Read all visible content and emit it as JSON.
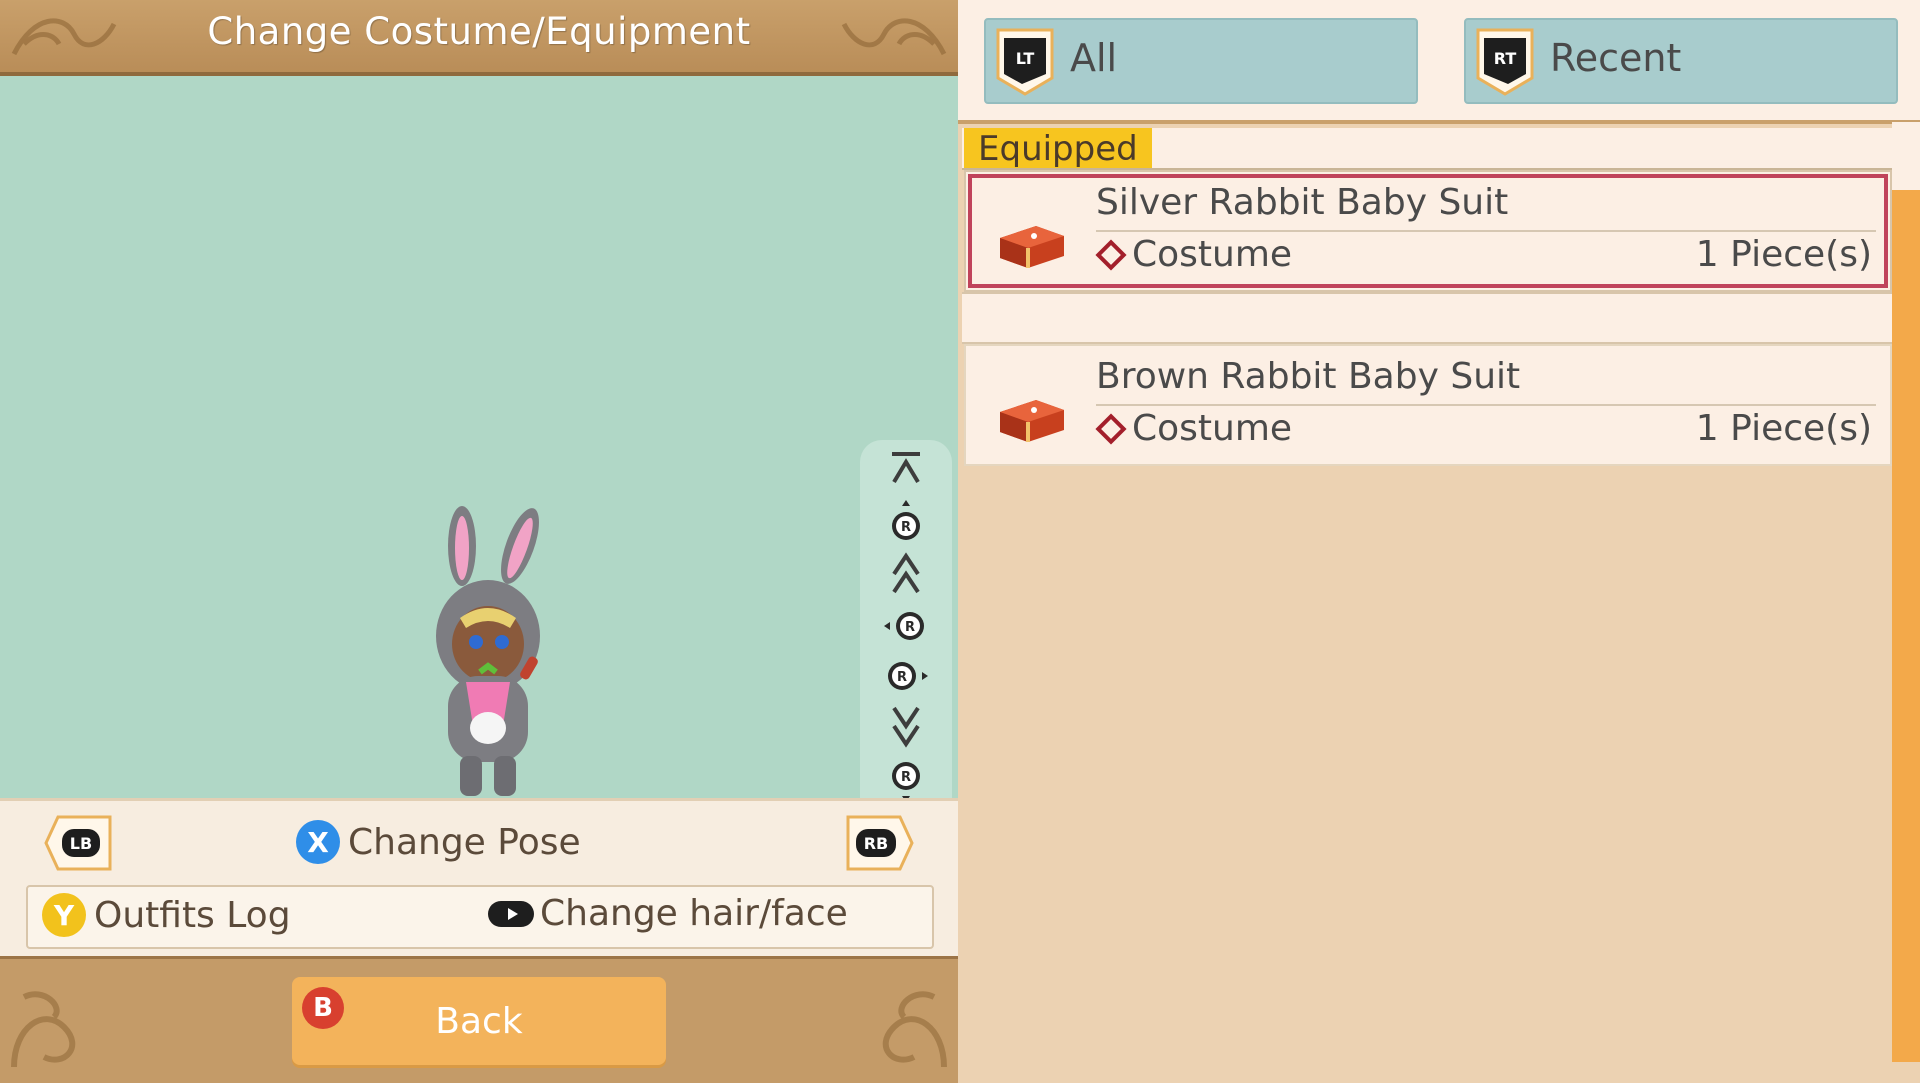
{
  "header": {
    "title": "Change Costume/Equipment"
  },
  "controls": {
    "lb": "LB",
    "rb": "RB",
    "x": "X",
    "pose_label": "Change Pose",
    "y": "Y",
    "outfits_label": "Outfits Log",
    "hairface_label": "Change hair/face",
    "r": "R"
  },
  "footer": {
    "b": "B",
    "back_label": "Back"
  },
  "tabs": [
    {
      "badge": "LT",
      "label": "All"
    },
    {
      "badge": "RT",
      "label": "Recent"
    }
  ],
  "list": {
    "section_label": "Equipped",
    "items": [
      {
        "name": "Silver Rabbit Baby Suit",
        "type": "Costume",
        "qty": "1 Piece(s)",
        "selected": true
      },
      {
        "name": "Brown Rabbit Baby Suit",
        "type": "Costume",
        "qty": "1 Piece(s)",
        "selected": false
      }
    ]
  },
  "colors": {
    "preview_bg": "#b0d7c6",
    "selection_border": "#c0435b",
    "section_tag": "#f7c51f",
    "back_button": "#f3b35b",
    "tab_bg": "#a8cccd"
  }
}
